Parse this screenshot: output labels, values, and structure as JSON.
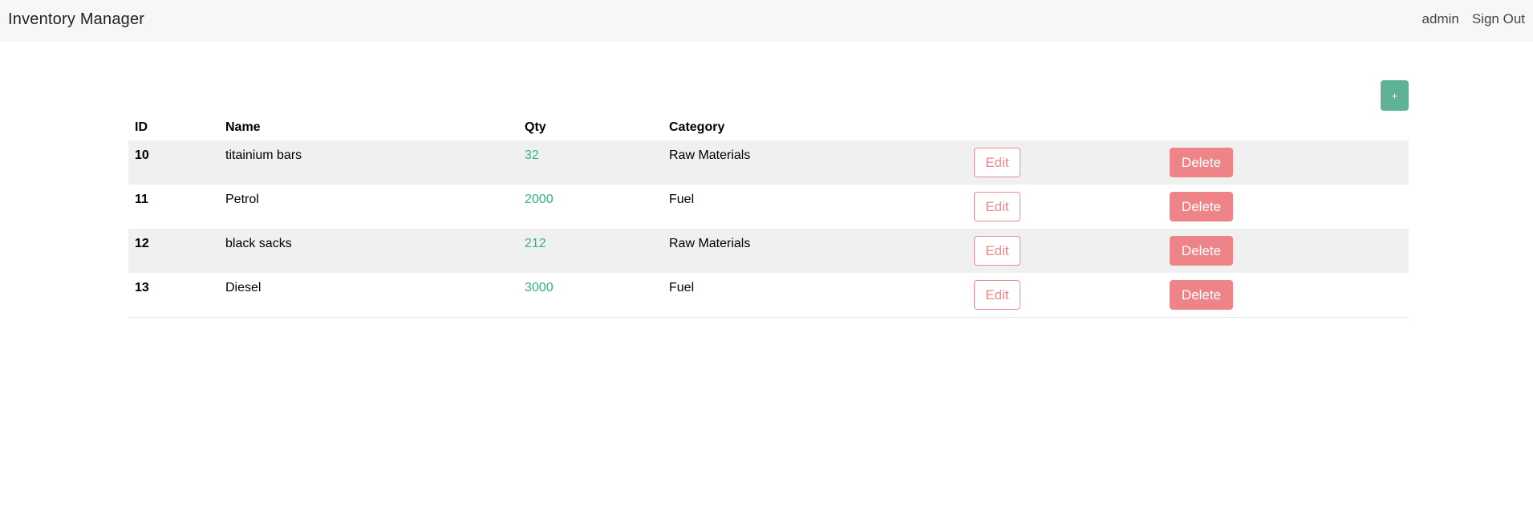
{
  "navbar": {
    "brand": "Inventory Manager",
    "user": "admin",
    "sign_out": "Sign Out"
  },
  "toolbar": {
    "add_label": "+"
  },
  "table": {
    "headers": {
      "id": "ID",
      "name": "Name",
      "qty": "Qty",
      "category": "Category"
    },
    "rows": [
      {
        "id": "10",
        "name": "titainium bars",
        "qty": "32",
        "category": "Raw Materials",
        "edit": "Edit",
        "delete": "Delete"
      },
      {
        "id": "11",
        "name": "Petrol",
        "qty": "2000",
        "category": "Fuel",
        "edit": "Edit",
        "delete": "Delete"
      },
      {
        "id": "12",
        "name": "black sacks",
        "qty": "212",
        "category": "Raw Materials",
        "edit": "Edit",
        "delete": "Delete"
      },
      {
        "id": "13",
        "name": "Diesel",
        "qty": "3000",
        "category": "Fuel",
        "edit": "Edit",
        "delete": "Delete"
      }
    ]
  },
  "colors": {
    "navbar_bg": "#f6f7f9",
    "add_button": "#5eb395",
    "qty_text": "#32b47d",
    "edit_border": "#ec8b90",
    "delete_bg": "#ee8388",
    "row_stripe": "#f0f0f0"
  }
}
